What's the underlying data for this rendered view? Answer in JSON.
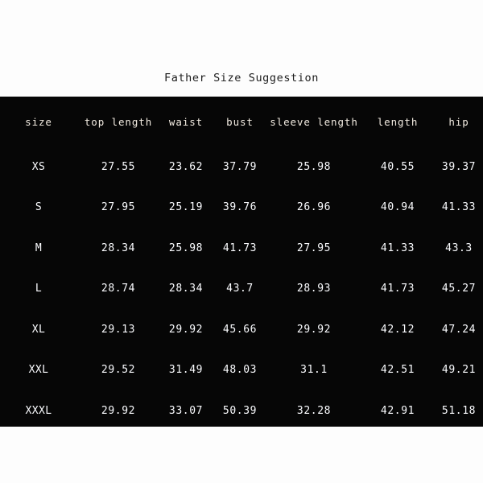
{
  "title": "Father Size Suggestion",
  "theme": {
    "page_background": "#fdfdfd",
    "panel_background": "#060606",
    "title_color": "#1c1c1c",
    "header_text_color": "#f3ece2",
    "data_text_color": "#fbfcff"
  },
  "table": {
    "columns": [
      {
        "key": "size",
        "label": "size"
      },
      {
        "key": "top_length",
        "label": "top length"
      },
      {
        "key": "waist",
        "label": "waist"
      },
      {
        "key": "bust",
        "label": "bust"
      },
      {
        "key": "sleeve_length",
        "label": "sleeve length"
      },
      {
        "key": "length",
        "label": "length"
      },
      {
        "key": "hip",
        "label": "hip"
      }
    ],
    "rows": [
      {
        "size": "XS",
        "top_length": "27.55",
        "waist": "23.62",
        "bust": "37.79",
        "sleeve_length": "25.98",
        "length": "40.55",
        "hip": "39.37"
      },
      {
        "size": "S",
        "top_length": "27.95",
        "waist": "25.19",
        "bust": "39.76",
        "sleeve_length": "26.96",
        "length": "40.94",
        "hip": "41.33"
      },
      {
        "size": "M",
        "top_length": "28.34",
        "waist": "25.98",
        "bust": "41.73",
        "sleeve_length": "27.95",
        "length": "41.33",
        "hip": "43.3"
      },
      {
        "size": "L",
        "top_length": "28.74",
        "waist": "28.34",
        "bust": "43.7",
        "sleeve_length": "28.93",
        "length": "41.73",
        "hip": "45.27"
      },
      {
        "size": "XL",
        "top_length": "29.13",
        "waist": "29.92",
        "bust": "45.66",
        "sleeve_length": "29.92",
        "length": "42.12",
        "hip": "47.24"
      },
      {
        "size": "XXL",
        "top_length": "29.52",
        "waist": "31.49",
        "bust": "48.03",
        "sleeve_length": "31.1",
        "length": "42.51",
        "hip": "49.21"
      },
      {
        "size": "XXXL",
        "top_length": "29.92",
        "waist": "33.07",
        "bust": "50.39",
        "sleeve_length": "32.28",
        "length": "42.91",
        "hip": "51.18"
      }
    ]
  }
}
